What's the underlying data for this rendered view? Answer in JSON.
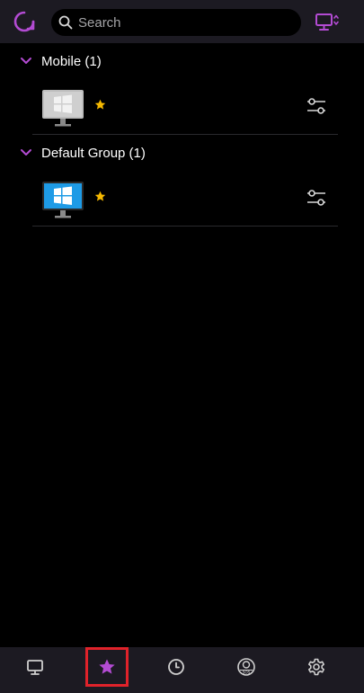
{
  "search": {
    "placeholder": "Search"
  },
  "groups": [
    {
      "title": "Mobile (1)",
      "devices": [
        {
          "monitor_style": "gray",
          "favorite": true
        }
      ]
    },
    {
      "title": "Default Group (1)",
      "devices": [
        {
          "monitor_style": "blue",
          "favorite": true
        }
      ]
    }
  ],
  "icons": {
    "logo": "refresh-circle-icon",
    "search": "search-icon",
    "device_switch": "monitor-switch-icon",
    "favorite": "star-icon",
    "settings": "sliders-icon"
  },
  "bottom_tabs": [
    {
      "name": "devices",
      "icon": "monitor-icon",
      "active": false
    },
    {
      "name": "favorites",
      "icon": "star-icon",
      "active": true
    },
    {
      "name": "history",
      "icon": "clock-icon",
      "active": false
    },
    {
      "name": "sos",
      "icon": "sos-icon",
      "active": false
    },
    {
      "name": "settings",
      "icon": "gear-icon",
      "active": false
    }
  ],
  "colors": {
    "accent": "#b34bd3",
    "background": "#000000",
    "bar": "#1c1a22",
    "star": "#f5b800",
    "highlight": "#e0222a"
  }
}
